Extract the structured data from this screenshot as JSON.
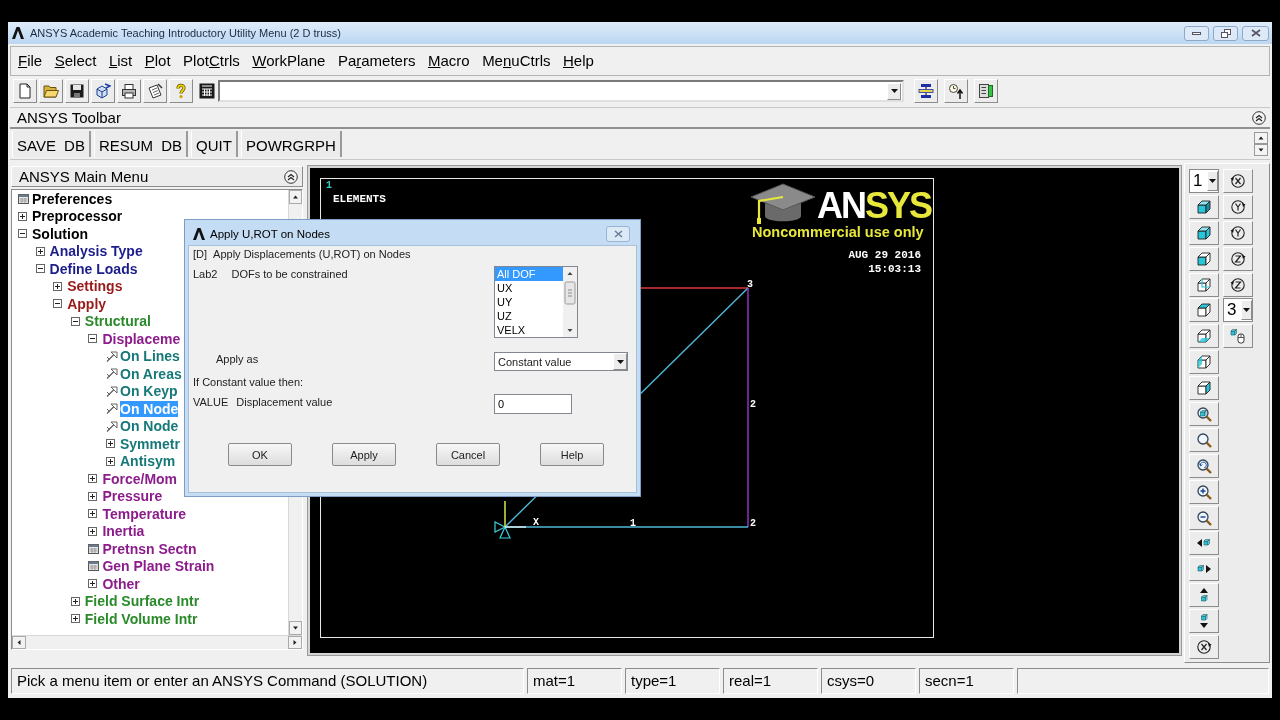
{
  "window": {
    "title": "ANSYS Academic Teaching Introductory Utility Menu (2 D truss)"
  },
  "menu_bar": [
    {
      "key": "F",
      "post": "ile"
    },
    {
      "key": "S",
      "post": "elect"
    },
    {
      "key": "L",
      "post": "ist"
    },
    {
      "key": "P",
      "post": "lot"
    },
    {
      "pre": "Plot",
      "key": "C",
      "post": "trls"
    },
    {
      "key": "W",
      "post": "orkPlane"
    },
    {
      "pre": "Pa",
      "key": "r",
      "post": "ameters"
    },
    {
      "key": "M",
      "post": "acro"
    },
    {
      "pre": "Me",
      "key": "n",
      "post": "uCtrls"
    },
    {
      "key": "H",
      "post": "elp"
    }
  ],
  "ansys_toolbar": {
    "title": "ANSYS Toolbar",
    "buttons": [
      "SAVE DB",
      "RESUM DB",
      "QUIT",
      "POWRGRPH"
    ]
  },
  "main_menu": {
    "title": "ANSYS Main Menu",
    "items": [
      {
        "label": "Preferences",
        "kind": "dialog",
        "selected": false
      },
      {
        "label": "Preprocessor",
        "kind": "folder",
        "expanded": false,
        "selected": false
      },
      {
        "label": "Solution",
        "kind": "folder",
        "expanded": true,
        "selected": false,
        "children": [
          {
            "label": "Analysis Type",
            "kind": "folder",
            "expanded": false,
            "selected": false
          },
          {
            "label": "Define Loads",
            "kind": "folder",
            "expanded": true,
            "selected": false,
            "children": [
              {
                "label": "Settings",
                "kind": "folder",
                "expanded": false,
                "selected": false
              },
              {
                "label": "Apply",
                "kind": "folder",
                "expanded": true,
                "selected": false,
                "children": [
                  {
                    "label": "Structural",
                    "kind": "folder",
                    "expanded": true,
                    "selected": false,
                    "children": [
                      {
                        "label": "Displaceme",
                        "kind": "folder",
                        "expanded": true,
                        "selected": false,
                        "children": [
                          {
                            "label": "On Lines",
                            "kind": "action",
                            "selected": false
                          },
                          {
                            "label": "On Areas",
                            "kind": "action",
                            "selected": false
                          },
                          {
                            "label": "On Keyp",
                            "kind": "action",
                            "selected": false
                          },
                          {
                            "label": "On Node",
                            "kind": "action",
                            "selected": true
                          },
                          {
                            "label": "On Node",
                            "kind": "action",
                            "selected": false
                          },
                          {
                            "label": "Symmetr",
                            "kind": "folder",
                            "expanded": false,
                            "selected": false
                          },
                          {
                            "label": "Antisym",
                            "kind": "folder",
                            "expanded": false,
                            "selected": false
                          }
                        ]
                      },
                      {
                        "label": "Force/Mom",
                        "kind": "folder",
                        "expanded": false,
                        "selected": false
                      },
                      {
                        "label": "Pressure",
                        "kind": "folder",
                        "expanded": false,
                        "selected": false
                      },
                      {
                        "label": "Temperature",
                        "kind": "folder",
                        "expanded": false,
                        "selected": false
                      },
                      {
                        "label": "Inertia",
                        "kind": "folder",
                        "expanded": false,
                        "selected": false
                      },
                      {
                        "label": "Pretnsn Sectn",
                        "kind": "dialog",
                        "selected": false
                      },
                      {
                        "label": "Gen Plane Strain",
                        "kind": "dialog",
                        "selected": false
                      },
                      {
                        "label": "Other",
                        "kind": "folder",
                        "expanded": false,
                        "selected": false
                      }
                    ]
                  },
                  {
                    "label": "Field Surface Intr",
                    "kind": "folder",
                    "expanded": false,
                    "selected": false
                  },
                  {
                    "label": "Field Volume Intr",
                    "kind": "folder",
                    "expanded": false,
                    "selected": false
                  }
                ]
              }
            ]
          }
        ]
      }
    ]
  },
  "graphics": {
    "corner_label": "1",
    "plot_label": "ELEMENTS",
    "logo": {
      "parts": [
        {
          "text": "AN",
          "color": "#ffffff"
        },
        {
          "text": "SYS",
          "color": "#e8e83c"
        }
      ],
      "caption": "Noncommercial use only"
    },
    "date": "AUG 29 2016",
    "time": "15:03:13",
    "labels": [
      "3",
      "2",
      "X",
      "1",
      "2"
    ]
  },
  "view_toolbar": {
    "selects": [
      "1",
      "3"
    ]
  },
  "dialog": {
    "title": "Apply U,ROT on Nodes",
    "command": "[D]",
    "heading": "Apply Displacements (U,ROT) on Nodes",
    "dofs": {
      "code": "Lab2",
      "label": "DOFs to be constrained",
      "options": [
        {
          "label": "All DOF",
          "selected": true
        },
        {
          "label": "UX",
          "selected": false
        },
        {
          "label": "UY",
          "selected": false
        },
        {
          "label": "UZ",
          "selected": false
        },
        {
          "label": "VELX",
          "selected": false
        }
      ]
    },
    "apply_as": {
      "label": "Apply as",
      "value": "Constant value"
    },
    "note": "If Constant value then:",
    "value_field": {
      "code": "VALUE",
      "label": "Displacement value",
      "value": "0"
    },
    "buttons": [
      "OK",
      "Apply",
      "Cancel",
      "Help"
    ]
  },
  "status_bar": {
    "prompt": "Pick a menu item or enter an ANSYS Command (SOLUTION)",
    "fields": [
      "mat=1",
      "type=1",
      "real=1",
      "csys=0",
      "secn=1"
    ]
  }
}
